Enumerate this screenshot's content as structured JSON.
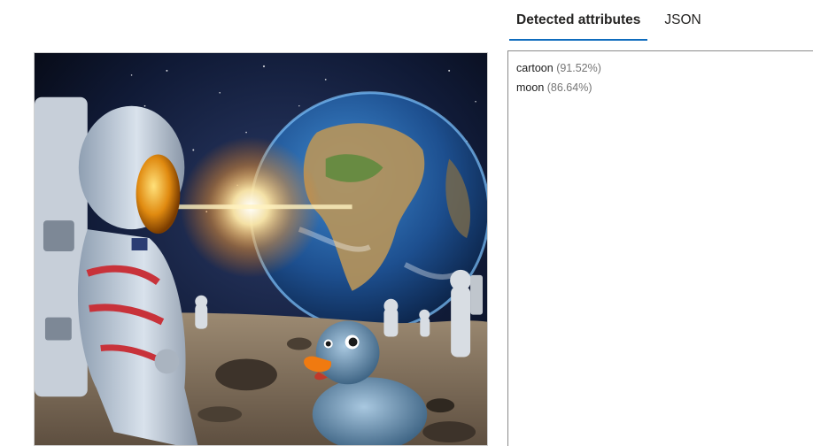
{
  "tabs": [
    {
      "label": "Detected attributes",
      "active": true
    },
    {
      "label": "JSON",
      "active": false
    }
  ],
  "attributes": [
    {
      "name": "cartoon",
      "confidence": "(91.52%)"
    },
    {
      "name": "moon",
      "confidence": "(86.64%)"
    }
  ],
  "colors": {
    "accent": "#0f6cbd",
    "panel_border": "#8a8a8a",
    "confidence_text": "#757575"
  },
  "image": {
    "subject": "astronaut duckling on moon with earth and sun flare"
  }
}
